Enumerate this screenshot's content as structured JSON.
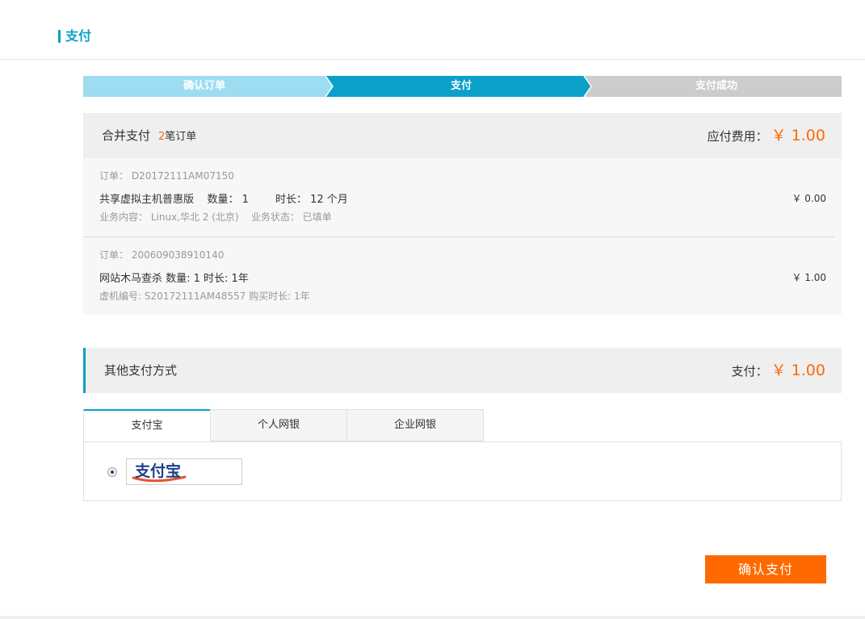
{
  "header": {
    "title": "支付"
  },
  "steps": [
    {
      "label": "确认订单",
      "state": "done",
      "color": "#9edcf2"
    },
    {
      "label": "支付",
      "state": "current",
      "color": "#0aa0c8"
    },
    {
      "label": "支付成功",
      "state": "pending",
      "color": "#cccccc"
    }
  ],
  "summary": {
    "title": "合并支付",
    "count_num": "2",
    "count_text": "笔订单",
    "fee_label": "应付费用：",
    "fee_amount": "￥ 1.00"
  },
  "orders": [
    {
      "order_no": "订单： D20172111AM07150",
      "line": "共享虚拟主机普惠版    数量： 1        时长： 12 个月",
      "sub": "业务内容： Linux,华北 2 (北京)    业务状态： 已填单",
      "price": "￥ 0.00"
    },
    {
      "order_no": "订单： 200609038910140",
      "line": "网站木马查杀 数量: 1 时长: 1年",
      "sub": "虚机编号: S20172111AM48557 购买时长: 1年",
      "price": "￥ 1.00"
    }
  ],
  "other_payment": {
    "title": "其他支付方式",
    "pay_label": "支付：",
    "pay_amount": "￥ 1.00"
  },
  "tabs": [
    {
      "label": "支付宝",
      "active": true
    },
    {
      "label": "个人网银",
      "active": false
    },
    {
      "label": "企业网银",
      "active": false
    }
  ],
  "alipay": {
    "logo_text": "支付宝",
    "selected": true
  },
  "confirm_button": "确认支付",
  "colors": {
    "accent": "#0aa0c8",
    "price": "#ff6a00"
  }
}
